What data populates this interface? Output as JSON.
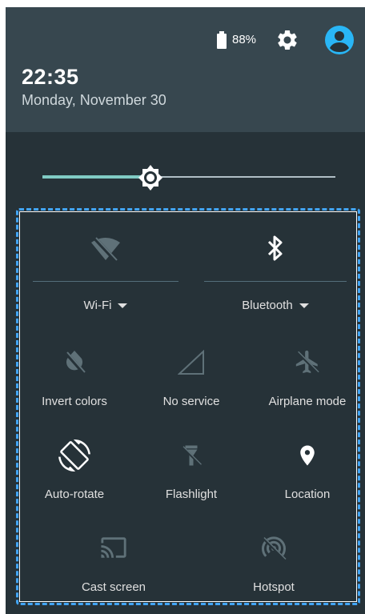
{
  "status": {
    "battery_level": "88%"
  },
  "header": {
    "time": "22:35",
    "date": "Monday, November 30"
  },
  "brightness": {
    "level": 0.37
  },
  "tiles": {
    "wifi": {
      "label": "Wi-Fi"
    },
    "bluetooth": {
      "label": "Bluetooth"
    },
    "invert": {
      "label": "Invert colors"
    },
    "service": {
      "label": "No service"
    },
    "airplane": {
      "label": "Airplane mode"
    },
    "rotate": {
      "label": "Auto-rotate"
    },
    "flashlight": {
      "label": "Flashlight"
    },
    "location": {
      "label": "Location"
    },
    "cast": {
      "label": "Cast screen"
    },
    "hotspot": {
      "label": "Hotspot"
    }
  },
  "colors": {
    "accent": "#80cbc4",
    "avatar": "#29b6f6",
    "panel_border": "#42a5f5",
    "header": "#37474f",
    "background": "#263238"
  }
}
